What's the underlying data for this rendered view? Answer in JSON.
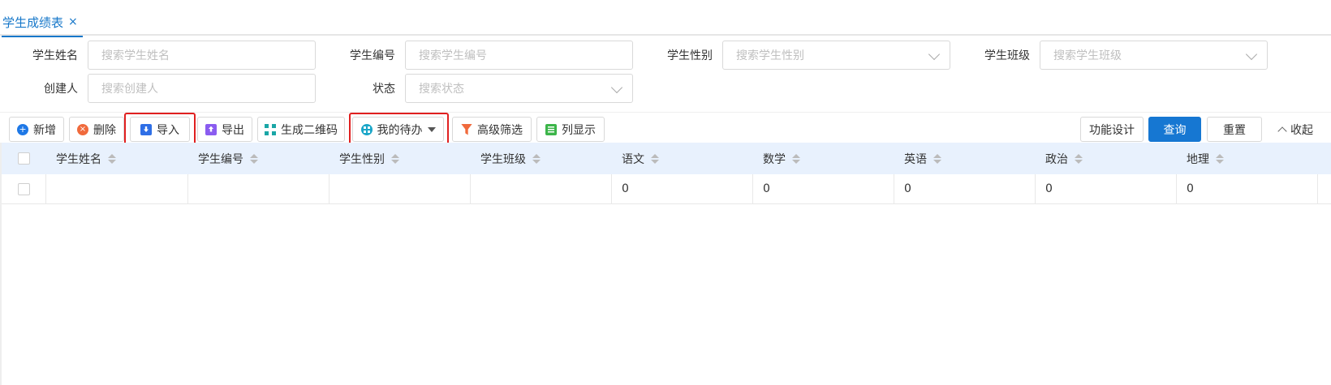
{
  "tab": {
    "title": "学生成绩表",
    "close": "×"
  },
  "form": {
    "fields": [
      {
        "label": "学生姓名",
        "placeholder": "搜索学生姓名",
        "type": "input"
      },
      {
        "label": "学生编号",
        "placeholder": "搜索学生编号",
        "type": "input"
      },
      {
        "label": "学生性别",
        "placeholder": "搜索学生性别",
        "type": "select"
      },
      {
        "label": "学生班级",
        "placeholder": "搜索学生班级",
        "type": "select"
      },
      {
        "label": "创建人",
        "placeholder": "搜索创建人",
        "type": "input"
      },
      {
        "label": "状态",
        "placeholder": "搜索状态",
        "type": "select"
      }
    ]
  },
  "toolbar": {
    "add": "新增",
    "delete": "删除",
    "import": "导入",
    "export": "导出",
    "qrcode": "生成二维码",
    "todo": "我的待办",
    "advanced_filter": "高级筛选",
    "columns": "列显示",
    "design": "功能设计",
    "query": "查询",
    "reset": "重置",
    "collapse": "收起"
  },
  "table": {
    "columns": [
      "学生姓名",
      "学生编号",
      "学生性别",
      "学生班级",
      "语文",
      "数学",
      "英语",
      "政治",
      "地理"
    ],
    "rows": [
      [
        "",
        "",
        "",
        "",
        "0",
        "0",
        "0",
        "0",
        "0"
      ]
    ]
  },
  "colors": {
    "accent": "#1677d2",
    "highlight": "#e02020",
    "header_bg": "#e8f1fd"
  }
}
